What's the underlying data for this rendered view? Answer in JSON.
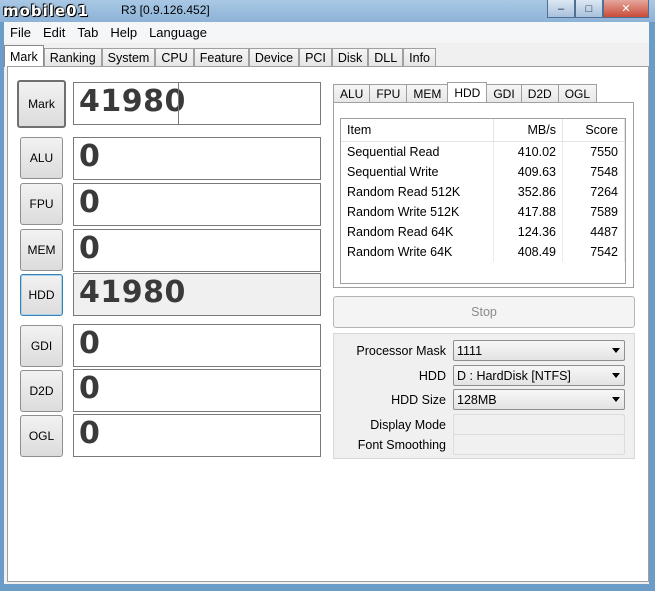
{
  "window": {
    "logo_text": "mobile01",
    "title": "R3 [0.9.126.452]",
    "controls": {
      "minimize": "–",
      "maximize": "□",
      "close": "✕"
    }
  },
  "menu": [
    "File",
    "Edit",
    "Tab",
    "Help",
    "Language"
  ],
  "main_tabs": [
    "Mark",
    "Ranking",
    "System",
    "CPU",
    "Feature",
    "Device",
    "PCI",
    "Disk",
    "DLL",
    "Info"
  ],
  "active_main_tab": "Mark",
  "scores": [
    {
      "label": "Mark",
      "value": "41980"
    },
    {
      "label": "ALU",
      "value": "0"
    },
    {
      "label": "FPU",
      "value": "0"
    },
    {
      "label": "MEM",
      "value": "0"
    },
    {
      "label": "HDD",
      "value": "41980"
    },
    {
      "label": "GDI",
      "value": "0"
    },
    {
      "label": "D2D",
      "value": "0"
    },
    {
      "label": "OGL",
      "value": "0"
    }
  ],
  "sub_tabs": [
    "ALU",
    "FPU",
    "MEM",
    "HDD",
    "GDI",
    "D2D",
    "OGL"
  ],
  "active_sub_tab": "HDD",
  "results": {
    "columns": [
      "Item",
      "MB/s",
      "Score"
    ],
    "rows": [
      [
        "Sequential Read",
        "410.02",
        "7550"
      ],
      [
        "Sequential Write",
        "409.63",
        "7548"
      ],
      [
        "Random Read 512K",
        "352.86",
        "7264"
      ],
      [
        "Random Write 512K",
        "417.88",
        "7589"
      ],
      [
        "Random Read 64K",
        "124.36",
        "4487"
      ],
      [
        "Random Write 64K",
        "408.49",
        "7542"
      ]
    ]
  },
  "stop_label": "Stop",
  "settings": {
    "processor_mask": {
      "label": "Processor Mask",
      "value": "1111"
    },
    "hdd": {
      "label": "HDD",
      "value": "D : HardDisk [NTFS]"
    },
    "hdd_size": {
      "label": "HDD Size",
      "value": "128MB"
    },
    "display_mode": {
      "label": "Display Mode",
      "value": ""
    },
    "font_smoothing": {
      "label": "Font Smoothing",
      "value": ""
    }
  }
}
